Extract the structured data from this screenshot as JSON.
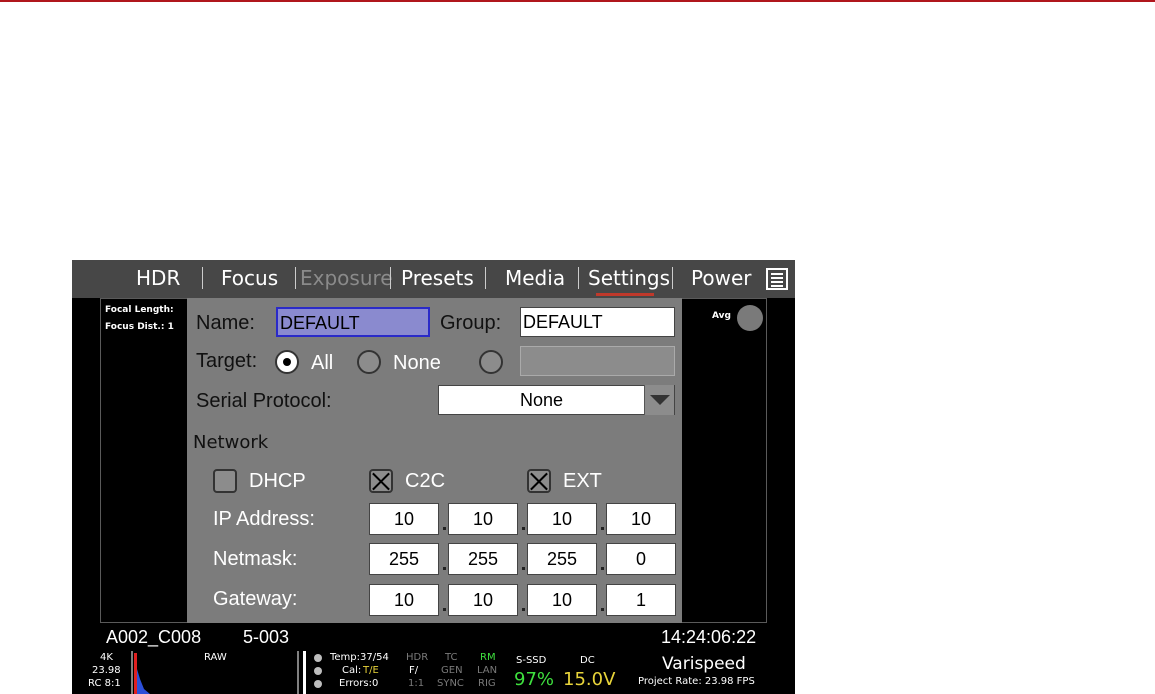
{
  "menu": {
    "items": [
      "HDR",
      "Focus",
      "Exposure",
      "Presets",
      "Media",
      "Settings",
      "Power"
    ],
    "active": "Settings",
    "disabled": "Exposure"
  },
  "overlay": {
    "focal_length": "Focal Length:",
    "focus_dist": "Focus Dist.: 1",
    "avg": "Avg"
  },
  "dialog": {
    "name_label": "Name:",
    "name_value": "DEFAULT",
    "group_label": "Group:",
    "group_value": "DEFAULT",
    "target_label": "Target:",
    "target_all": "All",
    "target_none": "None",
    "target_selected": "All",
    "serial_label": "Serial Protocol:",
    "serial_value": "None",
    "network_label": "Network",
    "dhcp_label": "DHCP",
    "dhcp_checked": false,
    "c2c_label": "C2C",
    "c2c_checked": true,
    "ext_label": "EXT",
    "ext_checked": true,
    "ip_label": "IP Address:",
    "ip": [
      "10",
      "10",
      "10",
      "10"
    ],
    "netmask_label": "Netmask:",
    "netmask": [
      "255",
      "255",
      "255",
      "0"
    ],
    "gateway_label": "Gateway:",
    "gateway": [
      "10",
      "10",
      "10",
      "1"
    ]
  },
  "lower": {
    "clip": "A002_C008",
    "shot": "5-003",
    "timecode": "14:24:06:22"
  },
  "status": {
    "res": "4K",
    "fps": "23.98",
    "rc": "RC 8:1",
    "raw": "RAW",
    "temp": "Temp:37/54",
    "cal_label": "Cal:",
    "cal_value": "T/E",
    "errors": "Errors:0",
    "hdr": "HDR",
    "f": "F/",
    "ratio": "1:1",
    "tc": "TC",
    "gen": "GEN",
    "sync": "SYNC",
    "rm": "RM",
    "lan": "LAN",
    "rig": "RIG",
    "media_label": "S-SSD",
    "media_value": "97%",
    "power_label": "DC",
    "power_value": "15.0V",
    "varispeed": "Varispeed",
    "project_rate": "Project Rate: 23.98 FPS"
  },
  "colors": {
    "accent": "#c0392b",
    "green": "#3ee03e",
    "yellow": "#e8d43a"
  }
}
